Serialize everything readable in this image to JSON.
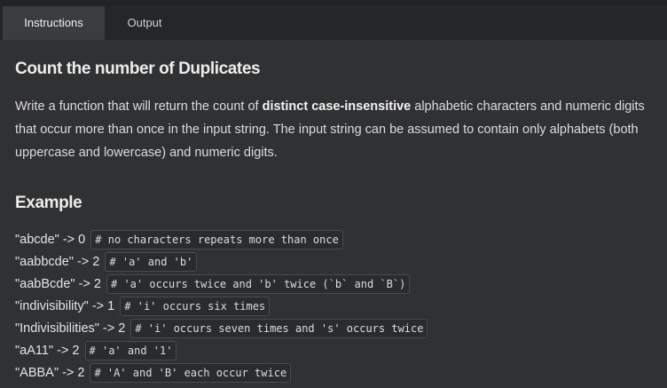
{
  "tabs": {
    "instructions": "Instructions",
    "output": "Output"
  },
  "kata": {
    "title": "Count the number of Duplicates",
    "description": {
      "part1": "Write a function that will return the count of ",
      "bold": "distinct case-insensitive",
      "part2": " alphabetic characters and numeric digits that occur more than once in the input string. The input string can be assumed to contain only alphabets (both uppercase and lowercase) and numeric digits."
    },
    "example_heading": "Example",
    "examples": [
      {
        "input": "\"abcde\" -> 0",
        "comment": "# no characters repeats more than once"
      },
      {
        "input": "\"aabbcde\" -> 2",
        "comment": "# 'a' and 'b'"
      },
      {
        "input": "\"aabBcde\" -> 2",
        "comment": "# 'a' occurs twice and 'b' twice (`b` and `B`)"
      },
      {
        "input": "\"indivisibility\" -> 1",
        "comment": "# 'i' occurs six times"
      },
      {
        "input": "\"Indivisibilities\" -> 2",
        "comment": "# 'i' occurs seven times and 's' occurs twice"
      },
      {
        "input": "\"aA11\" -> 2",
        "comment": "# 'a' and '1'"
      },
      {
        "input": "\"ABBA\" -> 2",
        "comment": "# 'A' and 'B' each occur twice"
      }
    ]
  }
}
